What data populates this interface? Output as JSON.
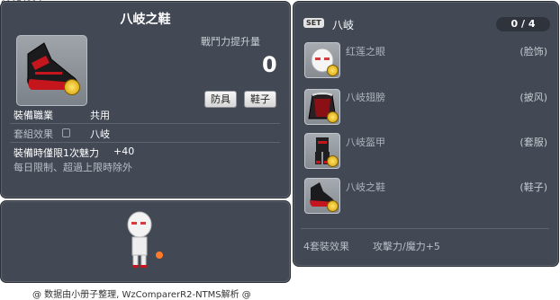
{
  "item_id": "01074214",
  "left_panel": {
    "title": "八岐之鞋",
    "power_label": "戰鬥力提升量",
    "power_value": "0",
    "tag_1": "防具",
    "tag_2": "鞋子",
    "job_label": "裝備職業",
    "job_value": "共用",
    "set_label": "套組效果",
    "set_value": "八岐",
    "equip_limit_label": "裝備時僅限1次魅力",
    "equip_limit_value": "+40",
    "daily_note": "每日限制、超過上限時除外"
  },
  "right_panel": {
    "set_badge": "SET",
    "set_title": "八岐",
    "count": "0 / 4",
    "items": [
      {
        "name": "红莲之眼",
        "slot": "(脸饰)",
        "icon": "face-accessory-icon"
      },
      {
        "name": "八岐翅膀",
        "slot": "(披风)",
        "icon": "cape-icon"
      },
      {
        "name": "八岐盔甲",
        "slot": "(套服)",
        "icon": "overall-armor-icon"
      },
      {
        "name": "八岐之鞋",
        "slot": "(鞋子)",
        "icon": "shoes-icon"
      }
    ],
    "bonus_count": "4套裝效果",
    "bonus_effect": "攻擊力/魔力+5"
  },
  "footer": "@ 数据由小册子整理, WzComparerR2-NTMS解析 @",
  "colors": {
    "panel_bg": "#424955",
    "panel_border": "#2c3038",
    "text_white": "#ffffff",
    "text_grey": "#b9bec6",
    "shoe_red": "#c4161c"
  }
}
